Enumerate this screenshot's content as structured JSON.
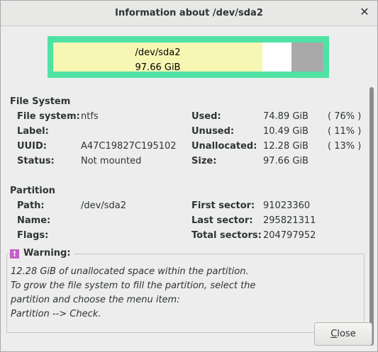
{
  "window": {
    "title": "Information about /dev/sda2"
  },
  "graph": {
    "path": "/dev/sda2",
    "size": "97.66 GiB",
    "used_pct": 76,
    "unused_pct": 11,
    "unallocated_pct": 13
  },
  "filesystem": {
    "section": "File System",
    "labels": {
      "fs": "File system:",
      "label": "Label:",
      "uuid": "UUID:",
      "status": "Status:",
      "used": "Used:",
      "unused": "Unused:",
      "unallocated": "Unallocated:",
      "size": "Size:"
    },
    "values": {
      "fs": "ntfs",
      "label": "",
      "uuid": "A47C19827C195102",
      "status": "Not mounted",
      "used": "74.89 GiB",
      "used_pct": "( 76% )",
      "unused": "10.49 GiB",
      "unused_pct": "( 11% )",
      "unallocated": "12.28 GiB",
      "unallocated_pct": "( 13% )",
      "size": "97.66 GiB"
    }
  },
  "partition": {
    "section": "Partition",
    "labels": {
      "path": "Path:",
      "name": "Name:",
      "flags": "Flags:",
      "first": "First sector:",
      "last": "Last sector:",
      "total": "Total sectors:"
    },
    "values": {
      "path": "/dev/sda2",
      "name": "",
      "flags": "",
      "first": "91023360",
      "last": "295821311",
      "total": "204797952"
    }
  },
  "warning": {
    "title": "Warning:",
    "icon": "!",
    "lines": [
      "12.28 GiB of unallocated space within the partition.",
      "To grow the file system to fill the partition, select the",
      "partition and choose the menu item:",
      "Partition --> Check."
    ]
  },
  "buttons": {
    "close_first": "C",
    "close_rest": "lose"
  },
  "colors": {
    "graph_border": "#4fe2a4",
    "used": "#f7f7b3",
    "unused": "#ffffff",
    "unallocated": "#a9a9a9",
    "warning_icon": "#c55fc7"
  }
}
